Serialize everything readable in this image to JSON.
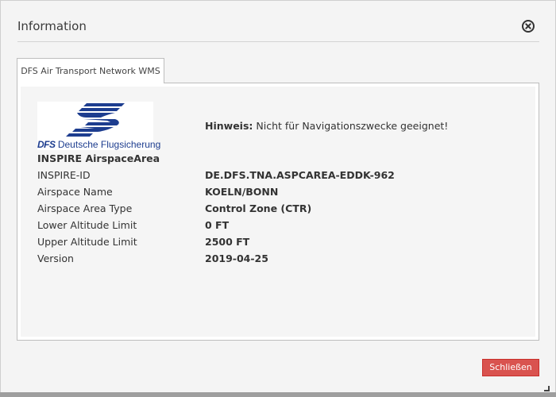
{
  "dialog": {
    "title": "Information",
    "tab_label": "DFS Air Transport Network WMS",
    "close_button_label": "Schließen"
  },
  "logo": {
    "brand_short": "DFS",
    "brand_long": "Deutsche Flugsicherung",
    "color": "#1d3d8f"
  },
  "hint": {
    "label": "Hinweis:",
    "text": "Nicht für Navigationszwecke geeignet!"
  },
  "feature": {
    "section_title": "INSPIRE AirspaceArea",
    "rows": [
      {
        "label": "INSPIRE-ID",
        "value": "DE.DFS.TNA.ASPCAREA-EDDK-962"
      },
      {
        "label": "Airspace Name",
        "value": "KOELN/BONN"
      },
      {
        "label": "Airspace Area Type",
        "value": "Control Zone (CTR)"
      },
      {
        "label": "Lower Altitude Limit",
        "value": "0 FT"
      },
      {
        "label": "Upper Altitude Limit",
        "value": "2500 FT"
      },
      {
        "label": "Version",
        "value": "2019-04-25"
      }
    ]
  },
  "colors": {
    "close_button": "#d9534f",
    "panel_background": "#f5f5f5"
  },
  "icons": {
    "close": "close-circle-icon",
    "resize": "resize-handle-icon"
  }
}
